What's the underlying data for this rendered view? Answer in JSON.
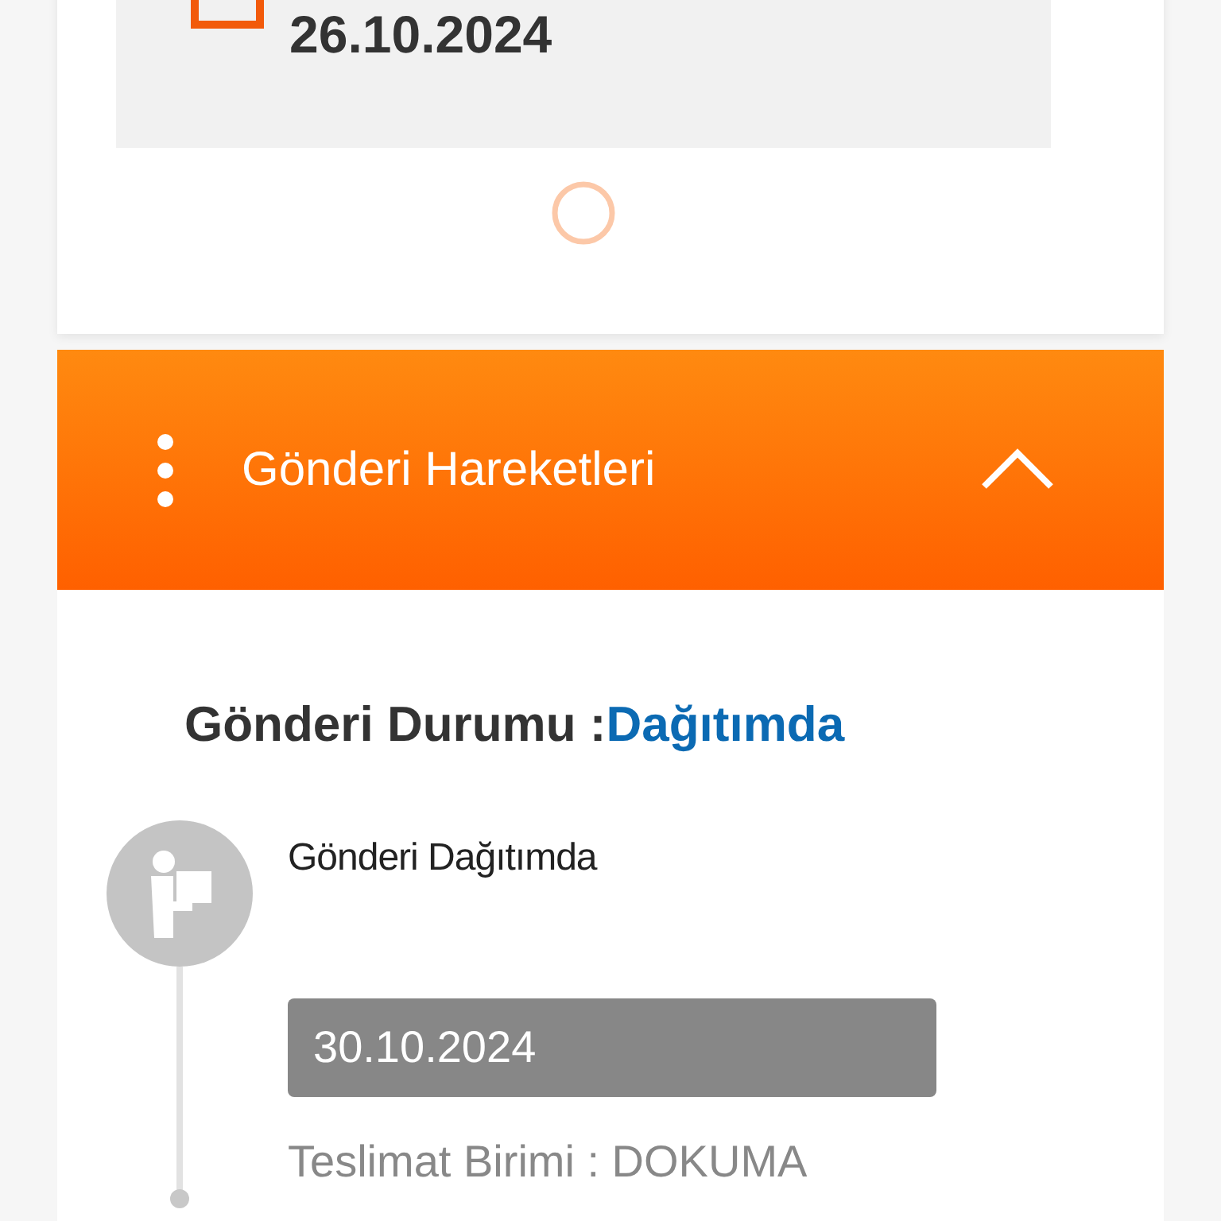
{
  "shipment_card": {
    "date": "26.10.2024"
  },
  "movements_panel": {
    "title": "Gönderi Hareketleri",
    "expanded": true,
    "status_label": "Gönderi Durumu :",
    "status_value": "Dağıtımda",
    "events": [
      {
        "title": "Gönderi Dağıtımda",
        "date": "30.10.2024",
        "detail": "Teslimat Birimi : DOKUMA"
      }
    ]
  }
}
